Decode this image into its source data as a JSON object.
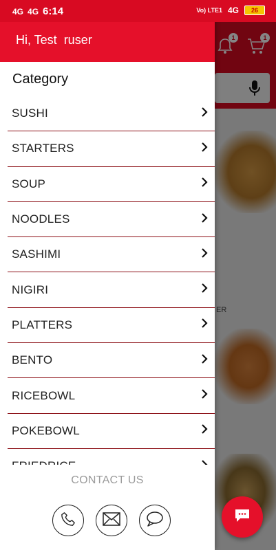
{
  "status_bar": {
    "network_left": "4G",
    "network_left2": "4G",
    "time": "6:14",
    "network_right": "Vo) LTE1",
    "network_right2": "4G",
    "battery": "26"
  },
  "background": {
    "bell_badge": "1",
    "cart_badge": "1",
    "partial_label": "ER"
  },
  "drawer": {
    "greeting": "Hi, Test  ruser",
    "category_title": "Category",
    "categories": [
      {
        "label": "SUSHI"
      },
      {
        "label": "STARTERS"
      },
      {
        "label": "SOUP"
      },
      {
        "label": "NOODLES"
      },
      {
        "label": "SASHIMI"
      },
      {
        "label": "NIGIRI"
      },
      {
        "label": "PLATTERS"
      },
      {
        "label": "BENTO"
      },
      {
        "label": "RICEBOWL"
      },
      {
        "label": "POKEBOWL"
      },
      {
        "label": "FRIEDRICE"
      }
    ],
    "contact_label": "CONTACT US"
  },
  "colors": {
    "brand_red": "#e5102a",
    "divider": "#8a0b12"
  },
  "icons": {
    "category_chevron": "chevron-right-icon",
    "contact": [
      "phone-icon",
      "mail-icon",
      "chat-bubble-icon"
    ],
    "fab": "chat-icon"
  }
}
